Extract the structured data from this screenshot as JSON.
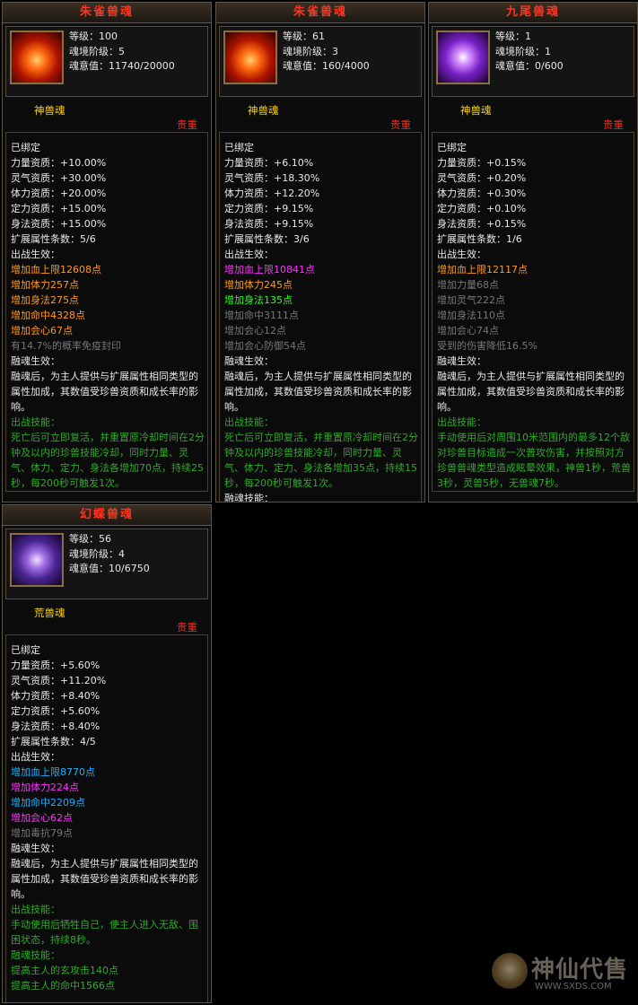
{
  "labels": {
    "level": "等级：",
    "tier": "魂境阶级：",
    "will": "魂意值：",
    "bound": "已绑定",
    "str": "力量资质：",
    "spirit": "灵气资质：",
    "con": "体力资质：",
    "focus": "定力资质：",
    "agi": "身法资质：",
    "ext": "扩展属性条数：",
    "battle_effect": "出战生效：",
    "fusion_effect": "融魂生效：",
    "fusion_desc": "融魂后，为主人提供与扩展属性相同类型的属性加成，其数值受珍兽资质和成长率的影响。",
    "battle_skill": "出战技能：",
    "fusion_skill": "融魂技能："
  },
  "panels": [
    {
      "title": "朱雀兽魂",
      "icon": "vermilion-bird-icon",
      "level": "100",
      "tier": "5",
      "will": "11740/20000",
      "kind": "神兽魂",
      "grade": "贵重",
      "stats": {
        "str": "+10.00%",
        "spirit": "+30.00%",
        "con": "+20.00%",
        "focus": "+15.00%",
        "agi": "+15.00%"
      },
      "ext": "5/6",
      "effects": [
        {
          "text": "增加血上限12608点",
          "color": "#ff9a1a"
        },
        {
          "text": "增加体力257点",
          "color": "#ff9a1a"
        },
        {
          "text": "增加身法275点",
          "color": "#ff9a1a"
        },
        {
          "text": "增加命中4328点",
          "color": "#ff9a1a"
        },
        {
          "text": "增加会心67点",
          "color": "#ff9a1a"
        },
        {
          "text": "有14.7%的概率免疫封印",
          "color": "#777777"
        }
      ],
      "skill": "死亡后可立即复活，并重置原冷却时间在2分钟及以内的珍兽技能冷却，同时力量、灵气、体力、定力、身法各增加70点，持续25秒，每200秒可触发1次。"
    },
    {
      "title": "朱雀兽魂",
      "icon": "vermilion-bird-icon",
      "level": "61",
      "tier": "3",
      "will": "160/4000",
      "kind": "神兽魂",
      "grade": "贵重",
      "stats": {
        "str": "+6.10%",
        "spirit": "+18.30%",
        "con": "+12.20%",
        "focus": "+9.15%",
        "agi": "+9.15%"
      },
      "ext": "3/6",
      "effects": [
        {
          "text": "增加血上限10841点",
          "color": "#ff30ff"
        },
        {
          "text": "增加体力245点",
          "color": "#ff9a1a"
        },
        {
          "text": "增加身法135点",
          "color": "#22ff22"
        },
        {
          "text": "增加命中3111点",
          "color": "#777777"
        },
        {
          "text": "增加会心12点",
          "color": "#777777"
        },
        {
          "text": "增加会心防御54点",
          "color": "#777777"
        }
      ],
      "skill": "死亡后可立即复活，并重置原冷却时间在2分钟及以内的珍兽技能冷却，同时力量、灵气、体力、定力、身法各增加35点，持续15秒，每200秒可触发1次。"
    },
    {
      "title": "九尾兽魂",
      "icon": "nine-tailed-fox-icon",
      "level": "1",
      "tier": "1",
      "will": "0/600",
      "kind": "神兽魂",
      "grade": "贵重",
      "stats": {
        "str": "+0.15%",
        "spirit": "+0.20%",
        "con": "+0.30%",
        "focus": "+0.10%",
        "agi": "+0.15%"
      },
      "ext": "1/6",
      "effects": [
        {
          "text": "增加血上限12117点",
          "color": "#ff9a1a"
        },
        {
          "text": "增加力量68点",
          "color": "#777777"
        },
        {
          "text": "增加灵气222点",
          "color": "#777777"
        },
        {
          "text": "增加身法110点",
          "color": "#777777"
        },
        {
          "text": "增加会心74点",
          "color": "#777777"
        },
        {
          "text": "受到的伤害降低16.5%",
          "color": "#777777"
        }
      ],
      "skill": "手动使用后对周围10米范围内的最多12个敌对珍兽目标造成一次普攻伤害，并按照对方珍兽兽魂类型造成眩晕效果，神兽1秒，荒兽3秒，灵兽5秒，无兽魂7秒。"
    },
    {
      "title": "幻蝶兽魂",
      "icon": "phantom-butterfly-icon",
      "level": "56",
      "tier": "4",
      "will": "10/6750",
      "kind": "荒兽魂",
      "grade": "贵重",
      "stats": {
        "str": "+5.60%",
        "spirit": "+11.20%",
        "con": "+8.40%",
        "focus": "+5.60%",
        "agi": "+8.40%"
      },
      "ext": "4/5",
      "effects": [
        {
          "text": "增加血上限8770点",
          "color": "#1ab0ff"
        },
        {
          "text": "增加体力224点",
          "color": "#ff30ff"
        },
        {
          "text": "增加命中2209点",
          "color": "#1ab0ff"
        },
        {
          "text": "增加会心62点",
          "color": "#ff30ff"
        },
        {
          "text": "增加毒抗79点",
          "color": "#777777"
        }
      ],
      "skill": "手动使用后牺牲自己，使主人进入无敌、围困状态，持续8秒。",
      "fusion_skills": [
        "提高主人的玄攻击140点",
        "提高主人的命中1566点"
      ]
    }
  ],
  "watermark": {
    "text": "神仙代售",
    "url": "WWW.SXDS.COM"
  }
}
